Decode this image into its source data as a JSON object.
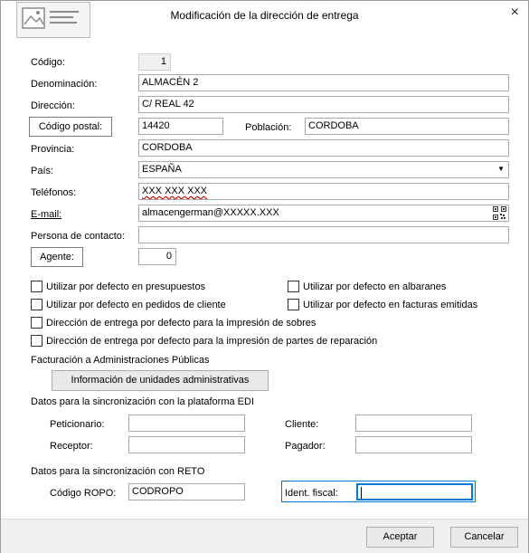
{
  "dialog": {
    "title": "Modificación de la dirección de entrega",
    "close_glyph": "×"
  },
  "fields": {
    "codigo": {
      "label": "Código:",
      "value": "1"
    },
    "denominacion": {
      "label": "Denominación:",
      "value": "ALMACÉN 2"
    },
    "direccion": {
      "label": "Dirección:",
      "value": "C/ REAL 42"
    },
    "codigo_postal": {
      "button_label": "Código postal:",
      "value": "14420"
    },
    "poblacion": {
      "label": "Población:",
      "value": "CORDOBA"
    },
    "provincia": {
      "label": "Provincia:",
      "value": "CORDOBA"
    },
    "pais": {
      "label": "País:",
      "value": "ESPAÑA"
    },
    "telefonos": {
      "label": "Teléfonos:",
      "value": "XXX XXX XXX"
    },
    "email": {
      "label": "E-mail:",
      "value": "almacengerman@XXXXX.XXX"
    },
    "persona_contacto": {
      "label": "Persona de contacto:",
      "value": ""
    },
    "agente": {
      "button_label": "Agente:",
      "value": "0"
    }
  },
  "checkboxes": {
    "presupuestos": "Utilizar por defecto en presupuestos",
    "albaranes": "Utilizar por defecto en albaranes",
    "pedidos": "Utilizar por defecto en pedidos de cliente",
    "facturas": "Utilizar por defecto en facturas emitidas",
    "sobres": "Dirección de entrega por defecto para la impresión de sobres",
    "partes": "Dirección de entrega por defecto para la impresión de partes de reparación"
  },
  "admin": {
    "section_label": "Facturación a Administraciones Públicas",
    "button_label": "Información de unidades administrativas"
  },
  "edi": {
    "section_label": "Datos para la sincronización con la plataforma EDI",
    "peticionario": {
      "label": "Peticionario:",
      "value": ""
    },
    "cliente": {
      "label": "Cliente:",
      "value": ""
    },
    "receptor": {
      "label": "Receptor:",
      "value": ""
    },
    "pagador": {
      "label": "Pagador:",
      "value": ""
    }
  },
  "reto": {
    "section_label": "Datos para la sincronización con RETO",
    "codigo_ropo": {
      "label": "Código ROPO:",
      "value": "CODROPO"
    },
    "ident_fiscal": {
      "label": "Ident. fiscal:",
      "value": ""
    }
  },
  "footer": {
    "accept_label": "Aceptar",
    "cancel_label": "Cancelar"
  },
  "colors": {
    "focus_border": "#0078d7",
    "misspell_underline": "#d00000"
  }
}
